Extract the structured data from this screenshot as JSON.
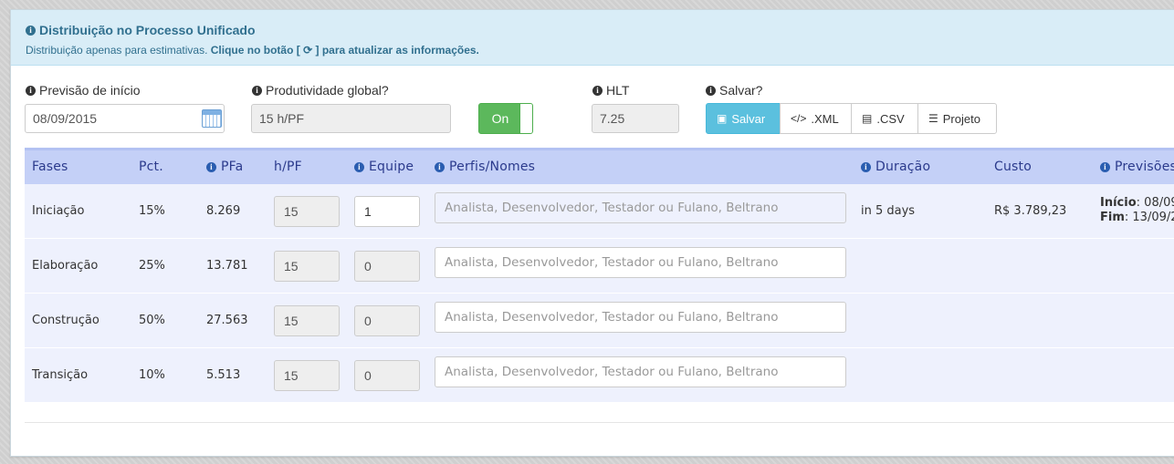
{
  "header": {
    "title": "Distribuição no Processo Unificado",
    "sub_text": "Distribuição apenas para estimativas. ",
    "sub_bold_a": "Clique no botão [ ",
    "sub_bold_b": " ] para atualizar as informações."
  },
  "form": {
    "start_label": "Previsão de início",
    "start_value": "08/09/2015",
    "productivity_label": "Produtividade global?",
    "productivity_value": "15 h/PF",
    "toggle_label": "On",
    "hlt_label": "HLT",
    "hlt_value": "7.25",
    "save_label": "Salvar?"
  },
  "buttons": {
    "save": "Salvar",
    "xml": ".XML",
    "csv": ".CSV",
    "project": "Projeto"
  },
  "table": {
    "headers": {
      "fases": "Fases",
      "pct": "Pct.",
      "pfa": "PFa",
      "hpf": "h/PF",
      "equipe": "Equipe",
      "perfis": "Perfis/Nomes",
      "duracao": "Duração",
      "custo": "Custo",
      "previsoes": "Previsões"
    },
    "placeholder": "Analista, Desenvolvedor, Testador ou Fulano, Beltrano",
    "rows": [
      {
        "fase": "Iniciação",
        "pct": "15%",
        "pfa": "8.269",
        "hpf": "15",
        "equipe": "1",
        "duracao": "in 5 days",
        "custo": "R$ 3.789,23",
        "inicio_label": "Início",
        "inicio": ": 08/09",
        "fim_label": "Fim",
        "fim": ": 13/09/2"
      },
      {
        "fase": "Elaboração",
        "pct": "25%",
        "pfa": "13.781",
        "hpf": "15",
        "equipe": "0",
        "duracao": "",
        "custo": ""
      },
      {
        "fase": "Construção",
        "pct": "50%",
        "pfa": "27.563",
        "hpf": "15",
        "equipe": "0",
        "duracao": "",
        "custo": ""
      },
      {
        "fase": "Transição",
        "pct": "10%",
        "pfa": "5.513",
        "hpf": "15",
        "equipe": "0",
        "duracao": "",
        "custo": ""
      }
    ]
  }
}
